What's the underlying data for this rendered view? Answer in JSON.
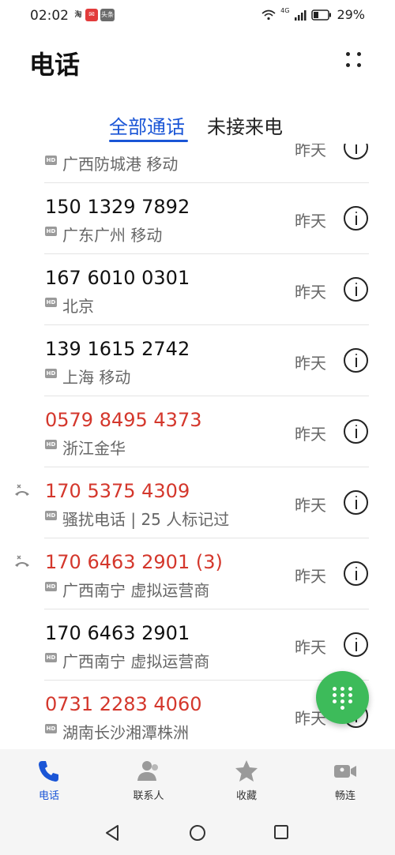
{
  "status_bar": {
    "time": "02:02",
    "mini_icons": [
      "淘",
      "头条"
    ],
    "network": "4G",
    "battery": "29%"
  },
  "header": {
    "title": "电话"
  },
  "tabs": [
    {
      "label": "全部通话",
      "active": true
    },
    {
      "label": "未接来电",
      "active": false
    }
  ],
  "calls": [
    {
      "number": "",
      "location": "广西防城港 移动",
      "time": "昨天",
      "missed": false,
      "partial": true
    },
    {
      "number": "150 1329 7892",
      "location": "广东广州 移动",
      "time": "昨天",
      "missed": false
    },
    {
      "number": "167 6010 0301",
      "location": "北京",
      "time": "昨天",
      "missed": false
    },
    {
      "number": "139 1615 2742",
      "location": "上海 移动",
      "time": "昨天",
      "missed": false
    },
    {
      "number": "0579 8495 4373",
      "location": "浙江金华",
      "time": "昨天",
      "missed": true
    },
    {
      "number": "170 5375 4309",
      "location": "骚扰电话 | 25 人标记过",
      "time": "昨天",
      "missed": true,
      "rejected": true
    },
    {
      "number": "170 6463 2901 (3)",
      "location": "广西南宁 虚拟运营商",
      "time": "昨天",
      "missed": true,
      "rejected": true
    },
    {
      "number": "170 6463 2901",
      "location": "广西南宁 虚拟运营商",
      "time": "昨天",
      "missed": false
    },
    {
      "number": "0731 2283 4060",
      "location": "湖南长沙湘潭株洲",
      "time": "昨天",
      "missed": true
    }
  ],
  "hd_badge": "HD",
  "bottom_nav": [
    {
      "label": "电话",
      "icon": "phone-icon",
      "active": true
    },
    {
      "label": "联系人",
      "icon": "contacts-icon",
      "active": false
    },
    {
      "label": "收藏",
      "icon": "star-icon",
      "active": false
    },
    {
      "label": "畅连",
      "icon": "video-call-icon",
      "active": false
    }
  ],
  "colors": {
    "accent": "#1a55d6",
    "missed": "#d4372c",
    "fab": "#3dbb5a"
  }
}
